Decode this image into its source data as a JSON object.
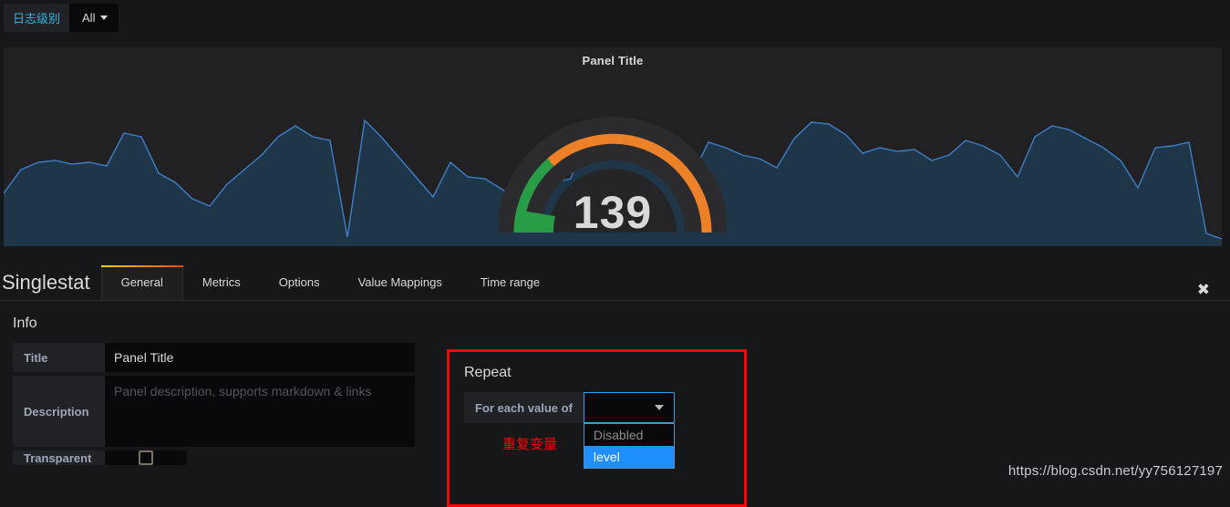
{
  "variable_bar": {
    "label": "日志级别",
    "value": "All",
    "caret_icon": "chevron-down-icon"
  },
  "panel": {
    "title": "Panel Title",
    "gauge_value": "139",
    "colors": {
      "gauge_low": "#299c46",
      "gauge_high": "#ed8128",
      "gauge_track": "#2b2b2e",
      "sparkline_line": "#3c7fc7",
      "sparkline_fill": "#1f3649",
      "panel_bg": "#212124"
    }
  },
  "editor": {
    "panel_type": "Singlestat",
    "close_icon": "close-icon",
    "tabs": [
      {
        "label": "General",
        "active": true
      },
      {
        "label": "Metrics",
        "active": false
      },
      {
        "label": "Options",
        "active": false
      },
      {
        "label": "Value Mappings",
        "active": false
      },
      {
        "label": "Time range",
        "active": false
      }
    ],
    "info": {
      "section_title": "Info",
      "title_label": "Title",
      "title_value": "Panel Title",
      "description_label": "Description",
      "description_placeholder": "Panel description, supports markdown & links",
      "description_value": "",
      "transparent_label": "Transparent",
      "transparent_checked": false
    },
    "repeat": {
      "section_title": "Repeat",
      "for_each_label": "For each value of",
      "selected_value": "",
      "options": [
        {
          "label": "Disabled",
          "selected": false
        },
        {
          "label": "level",
          "selected": true
        }
      ],
      "annotation": "重复变量",
      "highlight_color": "#ff0000"
    }
  },
  "watermark": {
    "text": "https://blog.csdn.net/yy756127197"
  },
  "chart_data": {
    "type": "area",
    "title": "Panel Title",
    "xlabel": "",
    "ylabel": "",
    "grid": false,
    "legend": "none",
    "series": [
      {
        "name": "sparkline",
        "values": [
          42,
          57,
          60,
          62,
          58,
          59,
          75,
          52,
          48,
          40,
          33,
          45,
          58,
          70,
          81,
          67,
          65,
          4,
          95,
          78,
          62,
          45,
          38,
          70,
          57,
          55,
          56,
          48,
          40,
          72,
          50,
          52,
          86,
          88,
          87,
          84,
          60,
          44,
          38,
          52,
          78,
          74,
          68,
          66,
          60,
          40,
          72,
          82,
          78,
          64,
          56,
          62,
          58,
          60,
          47,
          52,
          70,
          66,
          58,
          40,
          75,
          85,
          78,
          70,
          64,
          52,
          34,
          72,
          76,
          74,
          5
        ]
      }
    ],
    "gauge": {
      "type": "gauge",
      "value": 139,
      "min": 0,
      "max": 200,
      "thresholds": [
        {
          "from": 0,
          "color": "#299c46"
        },
        {
          "from": 40,
          "color": "#ed8128"
        }
      ],
      "start_angle": 180,
      "end_angle": 0
    }
  }
}
